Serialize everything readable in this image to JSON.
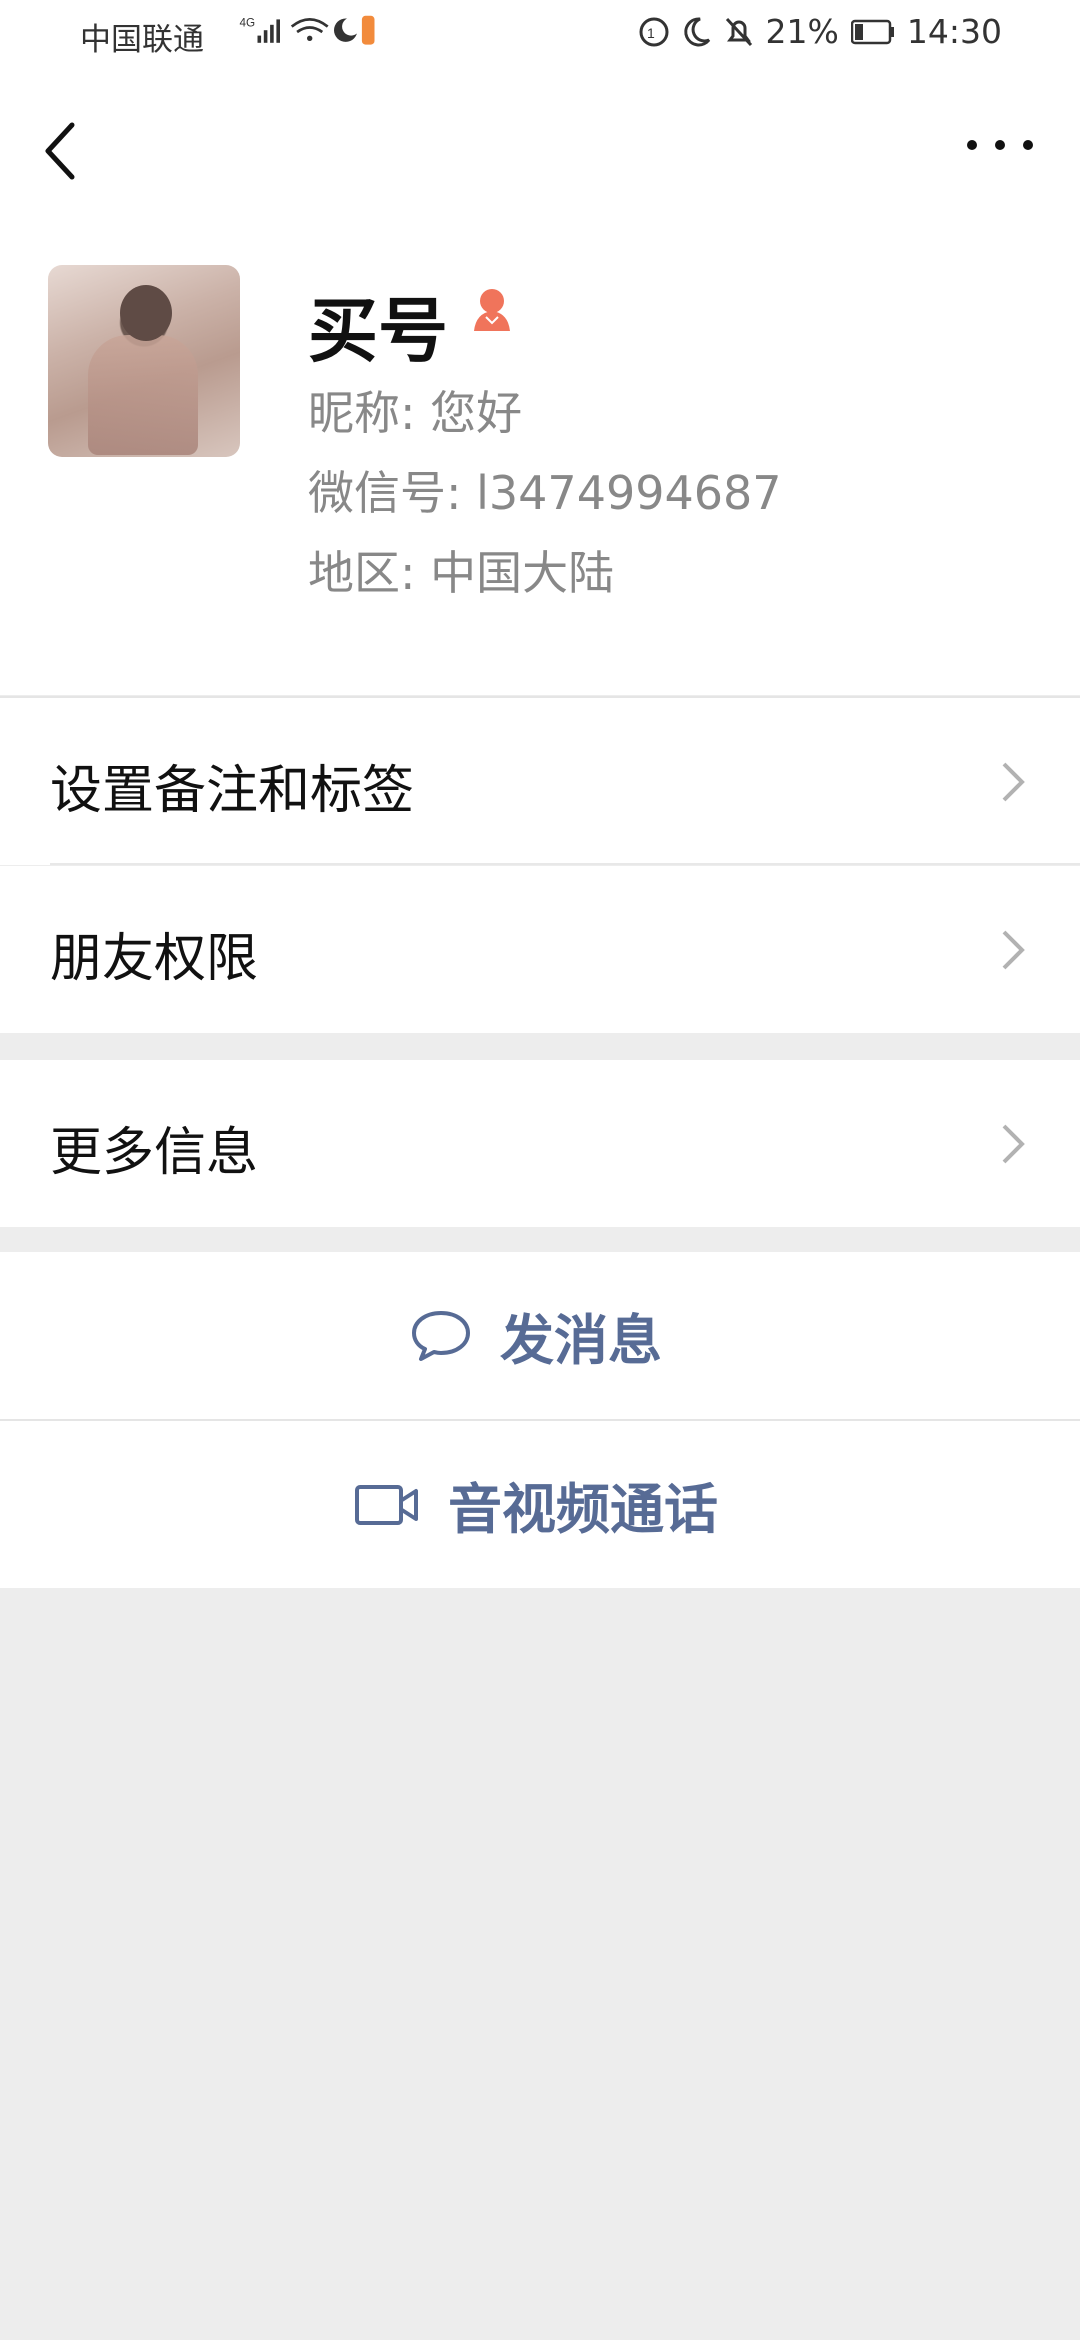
{
  "status_bar": {
    "carrier": "中国联通",
    "network": "4G",
    "battery": "21%",
    "time": "14:30",
    "icons": [
      "signal-icon",
      "wifi-icon",
      "moon-app-icon",
      "video-app-icon",
      "data-saver-icon",
      "do-not-disturb-icon",
      "mute-icon",
      "battery-icon"
    ]
  },
  "nav": {
    "back_icon": "back-chevron-icon",
    "more_icon": "more-dots-icon"
  },
  "profile": {
    "name": "买号",
    "gender_icon": "female-icon",
    "nickname": "昵称:  您好",
    "wechat_id": "微信号:  l3474994687",
    "region": "地区:  中国大陆"
  },
  "menu": {
    "remarks_tags": "设置备注和标签",
    "friend_permissions": "朋友权限",
    "more_info": "更多信息"
  },
  "actions": {
    "send_message": "发消息",
    "av_call": "音视频通话"
  },
  "colors": {
    "action_text": "#576b95",
    "background": "#ededed",
    "gender_icon": "#f0745b"
  }
}
